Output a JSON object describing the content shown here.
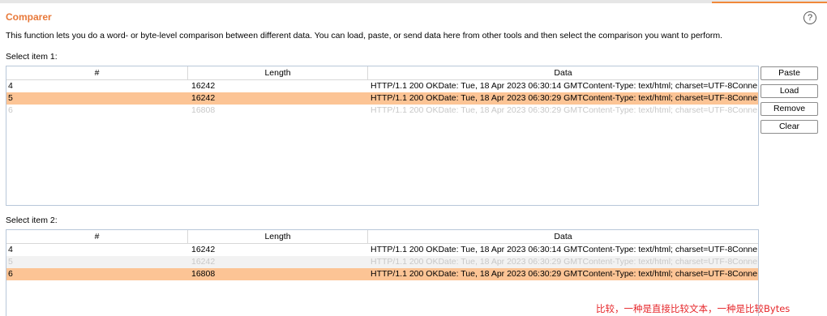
{
  "header": {
    "title": "Comparer",
    "help_symbol": "?",
    "description": "This function lets you do a word- or byte-level comparison between different data. You can load, paste, or send data here from other tools and then select the comparison you want to perform."
  },
  "item1": {
    "label": "Select item 1:",
    "columns": [
      "#",
      "Length",
      "Data"
    ],
    "rows": [
      {
        "num": "4",
        "length": "16242",
        "data": "HTTP/1.1 200 OKDate: Tue, 18 Apr 2023 06:30:14 GMTContent-Type: text/html; charset=UTF-8Conne...",
        "state": "normal"
      },
      {
        "num": "5",
        "length": "16242",
        "data": "HTTP/1.1 200 OKDate: Tue, 18 Apr 2023 06:30:29 GMTContent-Type: text/html; charset=UTF-8Conne...",
        "state": "selected"
      },
      {
        "num": "6",
        "length": "16808",
        "data": "HTTP/1.1 200 OKDate: Tue, 18 Apr 2023 06:30:29 GMTContent-Type: text/html; charset=UTF-8Conne...",
        "state": "disabled"
      }
    ]
  },
  "item2": {
    "label": "Select item 2:",
    "columns": [
      "#",
      "Length",
      "Data"
    ],
    "rows": [
      {
        "num": "4",
        "length": "16242",
        "data": "HTTP/1.1 200 OKDate: Tue, 18 Apr 2023 06:30:14 GMTContent-Type: text/html; charset=UTF-8Conne...",
        "state": "normal"
      },
      {
        "num": "5",
        "length": "16242",
        "data": "HTTP/1.1 200 OKDate: Tue, 18 Apr 2023 06:30:29 GMTContent-Type: text/html; charset=UTF-8Conne...",
        "state": "disabled"
      },
      {
        "num": "6",
        "length": "16808",
        "data": "HTTP/1.1 200 OKDate: Tue, 18 Apr 2023 06:30:29 GMTContent-Type: text/html; charset=UTF-8Conne...",
        "state": "selected"
      }
    ]
  },
  "buttons": {
    "paste": "Paste",
    "load": "Load",
    "remove": "Remove",
    "clear": "Clear"
  },
  "annotation": "比较，一种是直接比较文本，一种是比较Bytes",
  "colors": {
    "title": "#e8793a",
    "selected_row": "#fcc495",
    "annotation": "#e6262a",
    "tab_accent": "#f0883a"
  },
  "icons": {
    "help": "help-circle-icon"
  }
}
